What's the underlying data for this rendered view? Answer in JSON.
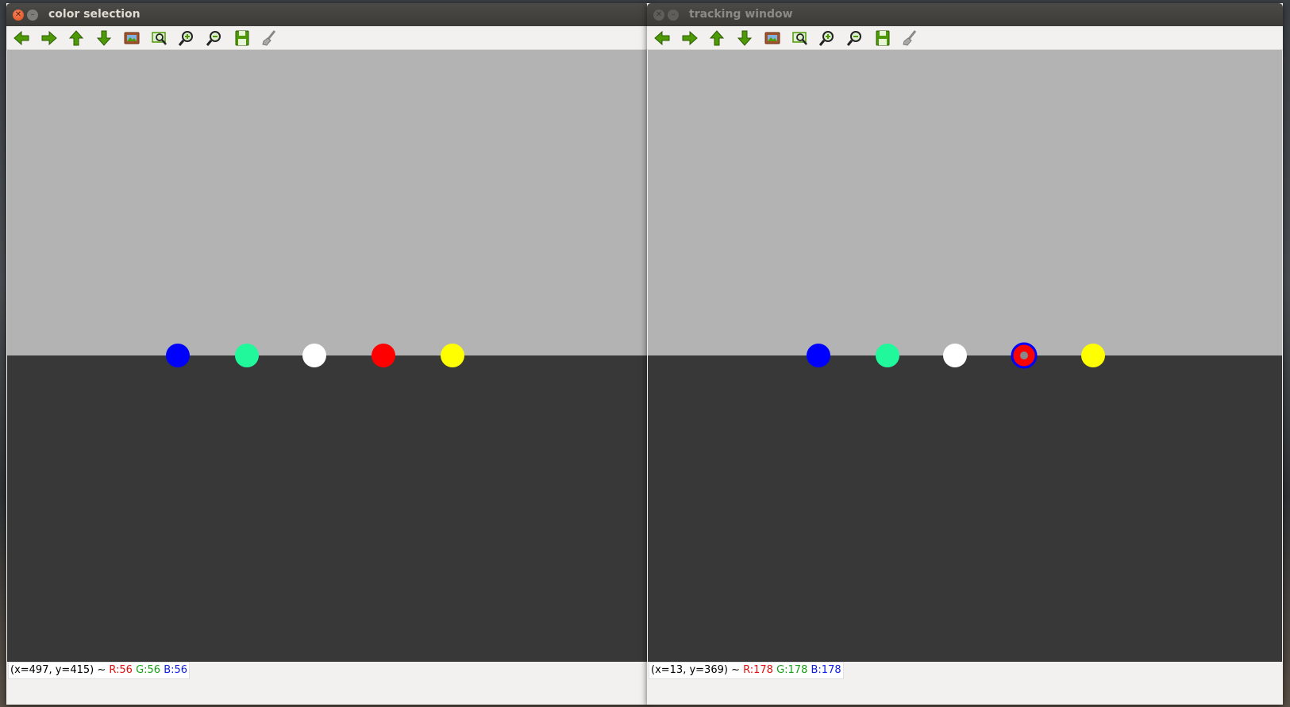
{
  "windows": [
    {
      "title": "color selection",
      "state": "active",
      "status": {
        "coords": "(x=497, y=415) ~",
        "r": "R:56",
        "g": "G:56",
        "b": "B:56"
      },
      "canvas": {
        "top_color": "#b3b3b3",
        "bottom_color": "#383838",
        "balls": [
          {
            "color": "#0000ff",
            "name": "blue-ball"
          },
          {
            "color": "#21f89b",
            "name": "green-ball"
          },
          {
            "color": "#ffffff",
            "name": "white-ball"
          },
          {
            "color": "#ff0000",
            "name": "red-ball"
          },
          {
            "color": "#ffff00",
            "name": "yellow-ball"
          }
        ],
        "tracked_ball": null
      }
    },
    {
      "title": "tracking window",
      "state": "inactive",
      "status": {
        "coords": "(x=13, y=369) ~",
        "r": "R:178",
        "g": "G:178",
        "b": "B:178"
      },
      "canvas": {
        "top_color": "#b3b3b3",
        "bottom_color": "#383838",
        "balls": [
          {
            "color": "#0000ff",
            "name": "blue-ball"
          },
          {
            "color": "#21f89b",
            "name": "green-ball"
          },
          {
            "color": "#ffffff",
            "name": "white-ball"
          },
          {
            "color": "#ff0000",
            "name": "red-ball"
          },
          {
            "color": "#ffff00",
            "name": "yellow-ball"
          }
        ],
        "tracked_ball": "red-ball"
      }
    }
  ],
  "toolbar_icons": [
    "pan-left-icon",
    "pan-right-icon",
    "pan-up-icon",
    "pan-down-icon",
    "zoom-original-icon",
    "zoom-fit-icon",
    "zoom-in-icon",
    "zoom-out-icon",
    "save-icon",
    "properties-icon"
  ],
  "colors": {
    "arrow_green": "#4e9a06",
    "tracking_ring": "#0000ff",
    "tracking_marker": "#ff0000"
  }
}
